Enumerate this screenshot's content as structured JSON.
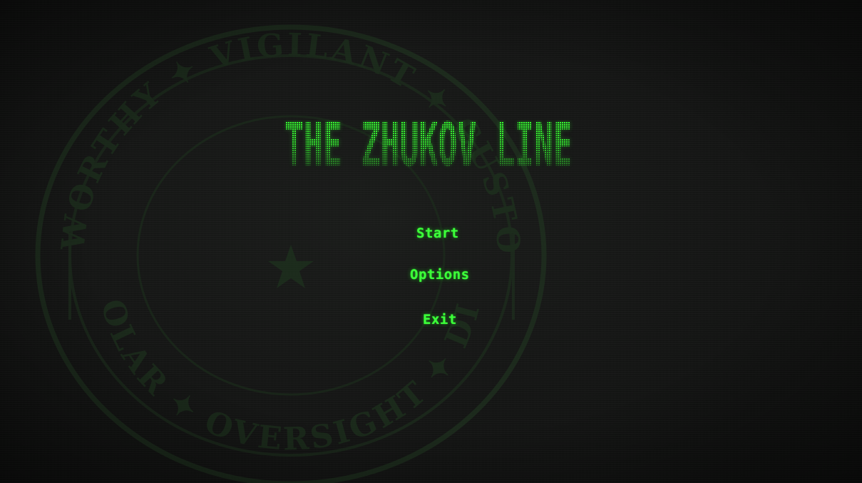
{
  "title": {
    "text": "THE ZHUKOV LINE"
  },
  "emblem": {
    "text_top": "TRUSTWORTHY ✦ VIGILANT ✦ CUSTODIANS",
    "text_bottom": "CHERNOLAR ✦ OVERSIGHT ✦ DIVISION"
  },
  "menu": {
    "start_label": "Start",
    "options_label": "Options",
    "exit_label": "Exit"
  },
  "colors": {
    "background": "#151515",
    "phosphor_green": "#3dff3a",
    "emblem_green": "#1f3a1f"
  }
}
